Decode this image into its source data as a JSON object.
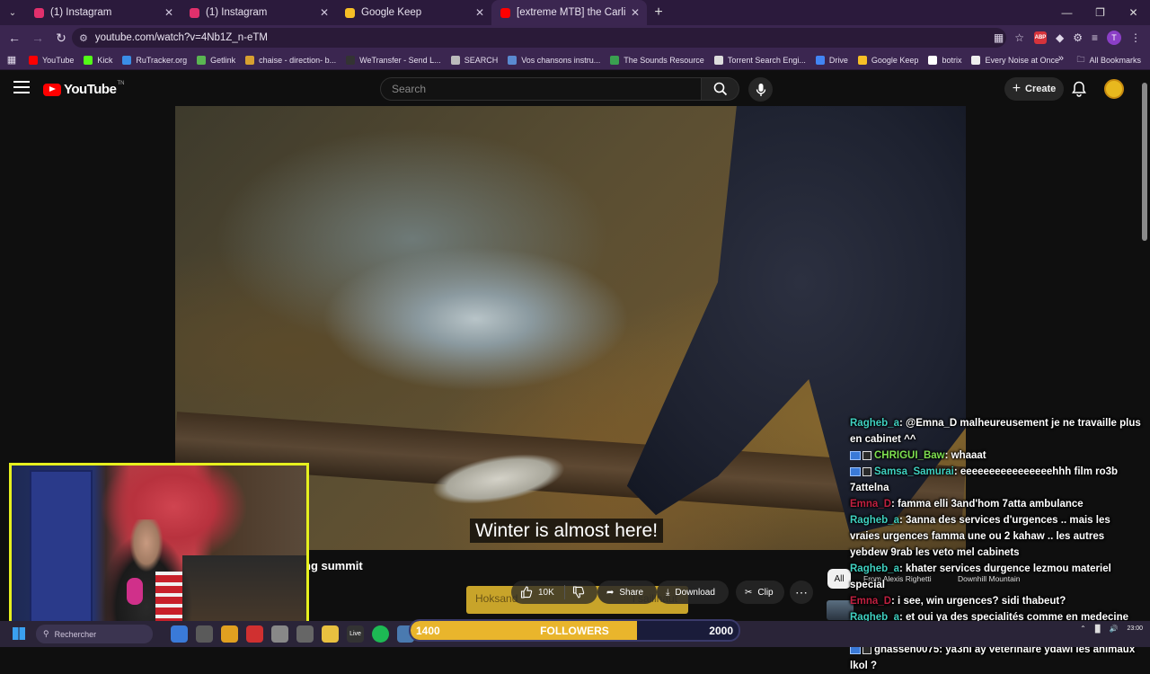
{
  "browser": {
    "tabs": [
      {
        "title": "(1) Instagram",
        "icon": "instagram-icon",
        "color": "#e1306c",
        "active": false
      },
      {
        "title": "(1) Instagram",
        "icon": "instagram-icon",
        "color": "#e1306c",
        "active": false
      },
      {
        "title": "Google Keep",
        "icon": "google-keep-icon",
        "color": "#f6bf26",
        "active": false
      },
      {
        "title": "[extreme MTB] the Carlit peak",
        "icon": "youtube-icon",
        "color": "#ff0000",
        "active": true
      }
    ],
    "url": "youtube.com/watch?v=4Nb1Z_n-eTM",
    "bookmarks": [
      {
        "label": "YouTube",
        "color": "#ff0000"
      },
      {
        "label": "Kick",
        "color": "#53fc18"
      },
      {
        "label": "RuTracker.org",
        "color": "#3a8ee6"
      },
      {
        "label": "Getlink",
        "color": "#5ab552"
      },
      {
        "label": "chaise - direction- b...",
        "color": "#d8a030"
      },
      {
        "label": "WeTransfer - Send L...",
        "color": "#333333"
      },
      {
        "label": "SEARCH",
        "color": "#bbbbbb"
      },
      {
        "label": "Vos chansons instru...",
        "color": "#5a8ad0"
      },
      {
        "label": "The Sounds Resource",
        "color": "#3aa050"
      },
      {
        "label": "Torrent Search Engi...",
        "color": "#dddddd"
      },
      {
        "label": "Drive",
        "color": "#4285f4"
      },
      {
        "label": "Google Keep",
        "color": "#f6bf26"
      },
      {
        "label": "botrix",
        "color": "#ffffff"
      },
      {
        "label": "Every Noise at Once",
        "color": "#eeeeee"
      }
    ],
    "all_bookmarks": "All Bookmarks",
    "profile_initial": "T"
  },
  "youtube": {
    "logo_text": "YouTube",
    "logo_sup": "TN",
    "search_placeholder": "Search",
    "create_label": "Create",
    "subtitle": "Winter is almost here!",
    "video_title_fragment": "ng summit",
    "promo_left": "Hoksand",
    "promo_right": "l saillhaut",
    "likes": "10K",
    "share_label": "Share",
    "download_label": "Download",
    "clip_label": "Clip",
    "chips": {
      "all": "All",
      "chip1": "From Alexis Righetti",
      "chip2": "Downhill Mountain"
    }
  },
  "chat": [
    {
      "user": "Ragheb_a",
      "color": "#3fd0c0",
      "text": ": @Emna_D malheureusement je ne travaille plus en cabinet ^^",
      "badge": false
    },
    {
      "user": "CHRIGUI_Baw",
      "color": "#7ee050",
      "text": ": whaaat",
      "badge": true
    },
    {
      "user": "Samsa_Samurai",
      "color": "#3fd0c0",
      "text": ": eeeeeeeeeeeeeeeehhh film ro3b 7attelna",
      "badge": true
    },
    {
      "user": "Emna_D",
      "color": "#c02040",
      "text": ": famma elli 3and'hom 7atta ambulance",
      "badge": false
    },
    {
      "user": "Ragheb_a",
      "color": "#3fd0c0",
      "text": ": 3anna des services d'urgences .. mais les vraies urgences famma une ou 2 kahaw .. les autres yebdew 9rab les veto mel cabinets",
      "badge": false
    },
    {
      "user": "Ragheb_a",
      "color": "#3fd0c0",
      "text": ": khater services durgence lezmou materiel special",
      "badge": false
    },
    {
      "user": "Emna_D",
      "color": "#c02040",
      "text": ": i see, win urgences? sidi thabeut?",
      "badge": false
    },
    {
      "user": "Ragheb_a",
      "color": "#3fd0c0",
      "text": ": et oui ya des specialités comme en medecine humaine tu fais plus 4ans detudes et tu fais une specialité",
      "badge": false
    },
    {
      "user": "ghassen0075",
      "color": "#ffffff",
      "text": ": ya3ni ay veterinaire ydawi les animaux lkol ?",
      "badge": true
    }
  ],
  "followers": {
    "min": "1400",
    "label": "FOLLOWERS",
    "max": "2000",
    "progress": 0.69
  },
  "taskbar": {
    "search_placeholder": "Rechercher",
    "time": "23:00"
  }
}
